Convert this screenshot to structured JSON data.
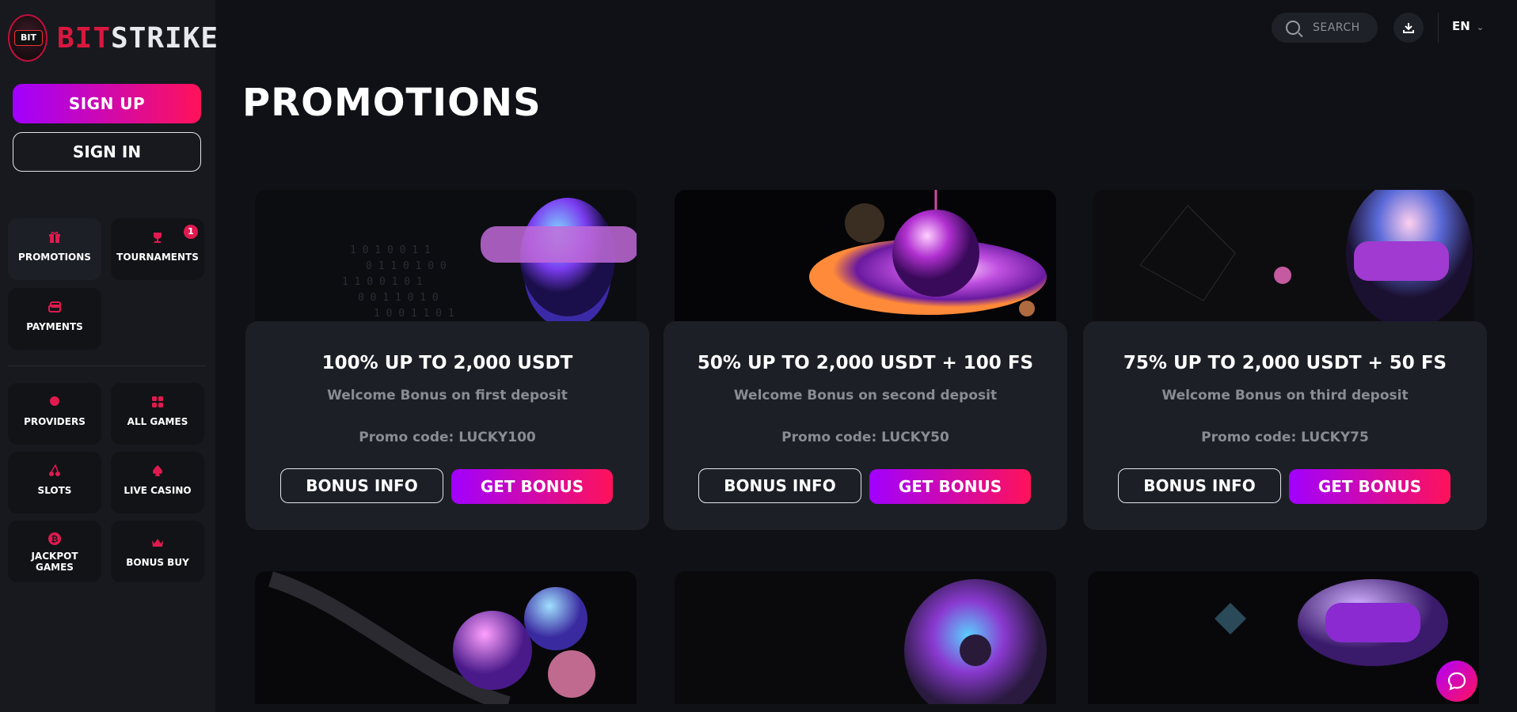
{
  "brand": {
    "logo_mark": "BIT",
    "name_red": "BIT",
    "name_white": "STRIKE"
  },
  "auth": {
    "signup": "SIGN UP",
    "signin": "SIGN IN"
  },
  "nav": {
    "promotions": {
      "label": "PROMOTIONS",
      "icon": "gift-icon"
    },
    "tournaments": {
      "label": "TOURNAMENTS",
      "icon": "trophy-icon",
      "badge": "1"
    },
    "payments": {
      "label": "PAYMENTS",
      "icon": "wallet-icon"
    },
    "providers": {
      "label": "PROVIDERS",
      "icon": "dot-icon"
    },
    "all_games": {
      "label": "ALL GAMES",
      "icon": "grid-icon"
    },
    "slots": {
      "label": "SLOTS",
      "icon": "cherry-icon"
    },
    "live_casino": {
      "label": "LIVE CASINO",
      "icon": "spade-icon"
    },
    "jackpot": {
      "label": "JACKPOT GAMES",
      "icon": "bitcoin-icon"
    },
    "bonus_buy": {
      "label": "BONUS BUY",
      "icon": "crown-icon"
    }
  },
  "header": {
    "search": "SEARCH",
    "lang": "EN"
  },
  "page": {
    "title": "PROMOTIONS"
  },
  "promos": [
    {
      "title": "100% UP TO 2,000 USDT",
      "subtitle": "Welcome Bonus on first deposit",
      "promo": "Promo code: LUCKY100",
      "info_label": "BONUS INFO",
      "get_label": "GET BONUS"
    },
    {
      "title": "50% UP TO 2,000 USDT + 100 FS",
      "subtitle": "Welcome Bonus on second deposit",
      "promo": "Promo code: LUCKY50",
      "info_label": "BONUS INFO",
      "get_label": "GET BONUS"
    },
    {
      "title": "75% UP TO 2,000 USDT + 50 FS",
      "subtitle": "Welcome Bonus on third deposit",
      "promo": "Promo code: LUCKY75",
      "info_label": "BONUS INFO",
      "get_label": "GET BONUS"
    }
  ],
  "colors": {
    "accent_start": "#a100ff",
    "accent_end": "#ff1259",
    "brand_red": "#d8183f"
  }
}
